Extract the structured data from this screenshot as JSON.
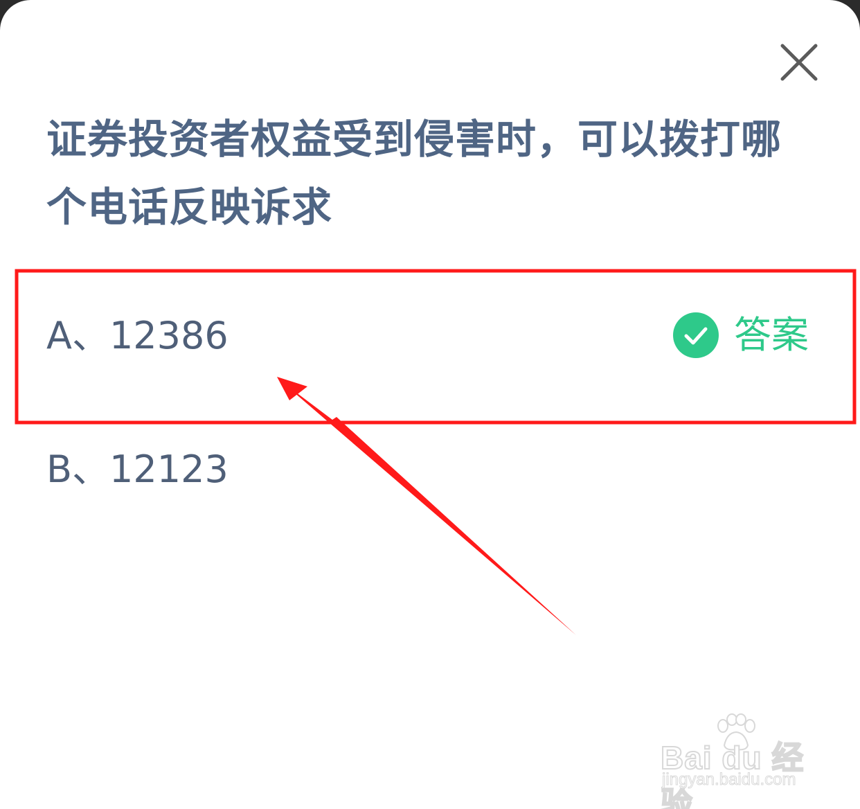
{
  "question": {
    "text": "证券投资者权益受到侵害时，可以拨打哪个电话反映诉求"
  },
  "options": [
    {
      "label": "A、12386",
      "is_answer": true
    },
    {
      "label": "B、12123",
      "is_answer": false
    }
  ],
  "answer_tag": {
    "label": "答案",
    "icon": "check-circle-icon",
    "color": "#2ec98a"
  },
  "close_button": {
    "icon": "close-icon"
  },
  "annotation": {
    "highlight_color": "#ff1a1a",
    "arrow_color": "#ff1a1a"
  },
  "watermark": {
    "brand": "Bai du 经验",
    "url": "jingyan.baidu.com"
  },
  "colors": {
    "question_text": "#4f6584",
    "option_text": "#4f5f78",
    "background": "#ffffff"
  }
}
